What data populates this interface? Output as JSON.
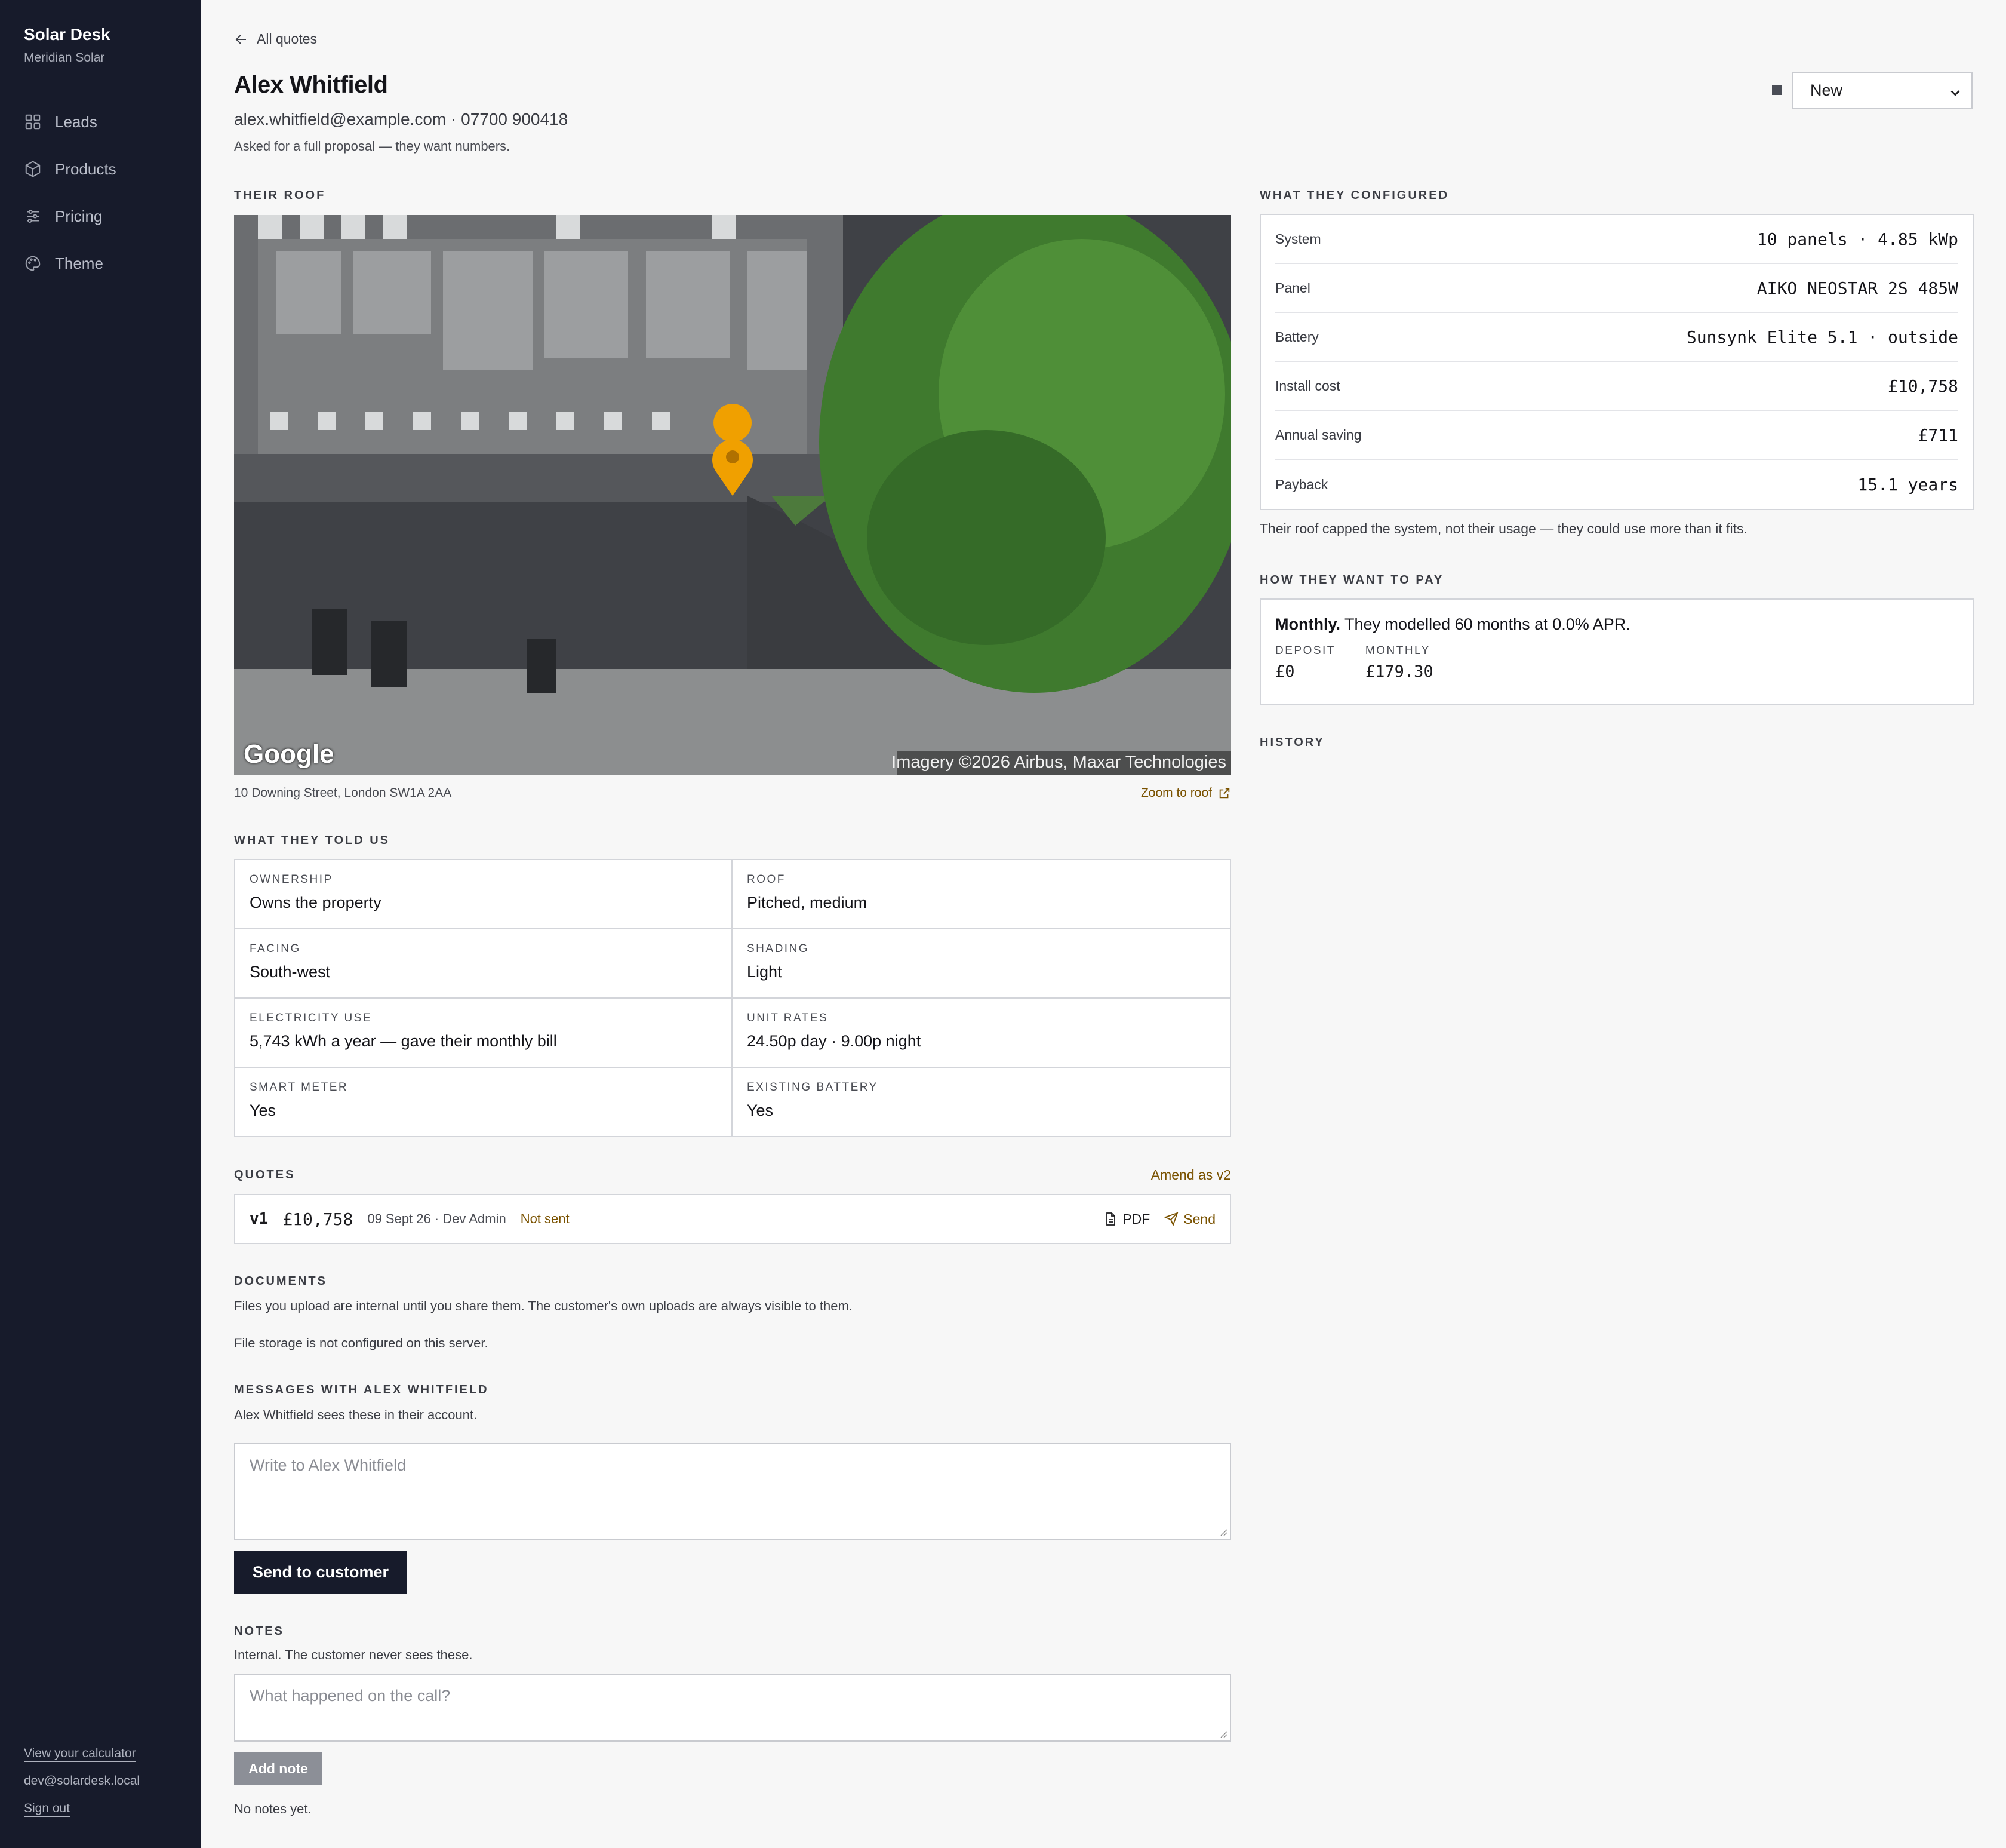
{
  "sidebar": {
    "brand": "Solar Desk",
    "company": "Meridian Solar",
    "items": [
      {
        "label": "Leads",
        "icon": "grid-icon"
      },
      {
        "label": "Products",
        "icon": "box-icon"
      },
      {
        "label": "Pricing",
        "icon": "sliders-icon"
      },
      {
        "label": "Theme",
        "icon": "palette-icon"
      }
    ],
    "calculator_link": "View your calculator",
    "user_email": "dev@solardesk.local",
    "sign_out": "Sign out"
  },
  "header": {
    "back_label": "All quotes",
    "customer_name": "Alex Whitfield",
    "contact": "alex.whitfield@example.com · 07700 900418",
    "note": "Asked for a full proposal — they want numbers.",
    "status_value": "New"
  },
  "roof": {
    "section": "Their roof",
    "address": "10 Downing Street, London SW1A 2AA",
    "zoom_label": "Zoom to roof",
    "map_brand": "Google",
    "map_credit": "Imagery ©2026 Airbus, Maxar Technologies"
  },
  "told": {
    "section": "What they told us",
    "items": [
      {
        "label": "Ownership",
        "value": "Owns the property"
      },
      {
        "label": "Roof",
        "value": "Pitched, medium"
      },
      {
        "label": "Facing",
        "value": "South-west"
      },
      {
        "label": "Shading",
        "value": "Light"
      },
      {
        "label": "Electricity use",
        "value": "5,743 kWh a year — gave their monthly bill"
      },
      {
        "label": "Unit rates",
        "value": "24.50p day · 9.00p night"
      },
      {
        "label": "Smart meter",
        "value": "Yes"
      },
      {
        "label": "Existing battery",
        "value": "Yes"
      }
    ]
  },
  "quotes": {
    "section": "Quotes",
    "amend_label": "Amend as v2",
    "rows": [
      {
        "version": "v1",
        "amount": "£10,758",
        "meta": "09 Sept 26 · Dev Admin",
        "status": "Not sent",
        "pdf_label": "PDF",
        "send_label": "Send"
      }
    ]
  },
  "documents": {
    "section": "Documents",
    "description": "Files you upload are internal until you share them. The customer's own uploads are always visible to them.",
    "status": "File storage is not configured on this server."
  },
  "messages": {
    "section": "Messages with Alex Whitfield",
    "description": "Alex Whitfield sees these in their account.",
    "placeholder": "Write to Alex Whitfield",
    "send_label": "Send to customer"
  },
  "notes": {
    "section": "Notes",
    "description": "Internal. The customer never sees these.",
    "placeholder": "What happened on the call?",
    "add_label": "Add note",
    "empty": "No notes yet."
  },
  "configured": {
    "section": "What they configured",
    "rows": [
      {
        "label": "System",
        "value": "10 panels · 4.85 kWp"
      },
      {
        "label": "Panel",
        "value": "AIKO NEOSTAR 2S 485W"
      },
      {
        "label": "Battery",
        "value": "Sunsynk Elite 5.1 · outside"
      },
      {
        "label": "Install cost",
        "value": "£10,758"
      },
      {
        "label": "Annual saving",
        "value": "£711"
      },
      {
        "label": "Payback",
        "value": "15.1 years"
      }
    ],
    "note": "Their roof capped the system, not their usage — they could use more than it fits."
  },
  "payment": {
    "section": "How they want to pay",
    "method": "Monthly.",
    "detail": "They modelled 60 months at 0.0% APR.",
    "deposit_label": "DEPOSIT",
    "deposit_value": "£0",
    "monthly_label": "MONTHLY",
    "monthly_value": "£179.30"
  },
  "history": {
    "section": "History"
  },
  "colors": {
    "sidebar_bg": "#171b2b",
    "accent_amber": "#7a5200",
    "pin": "#f0a000"
  }
}
